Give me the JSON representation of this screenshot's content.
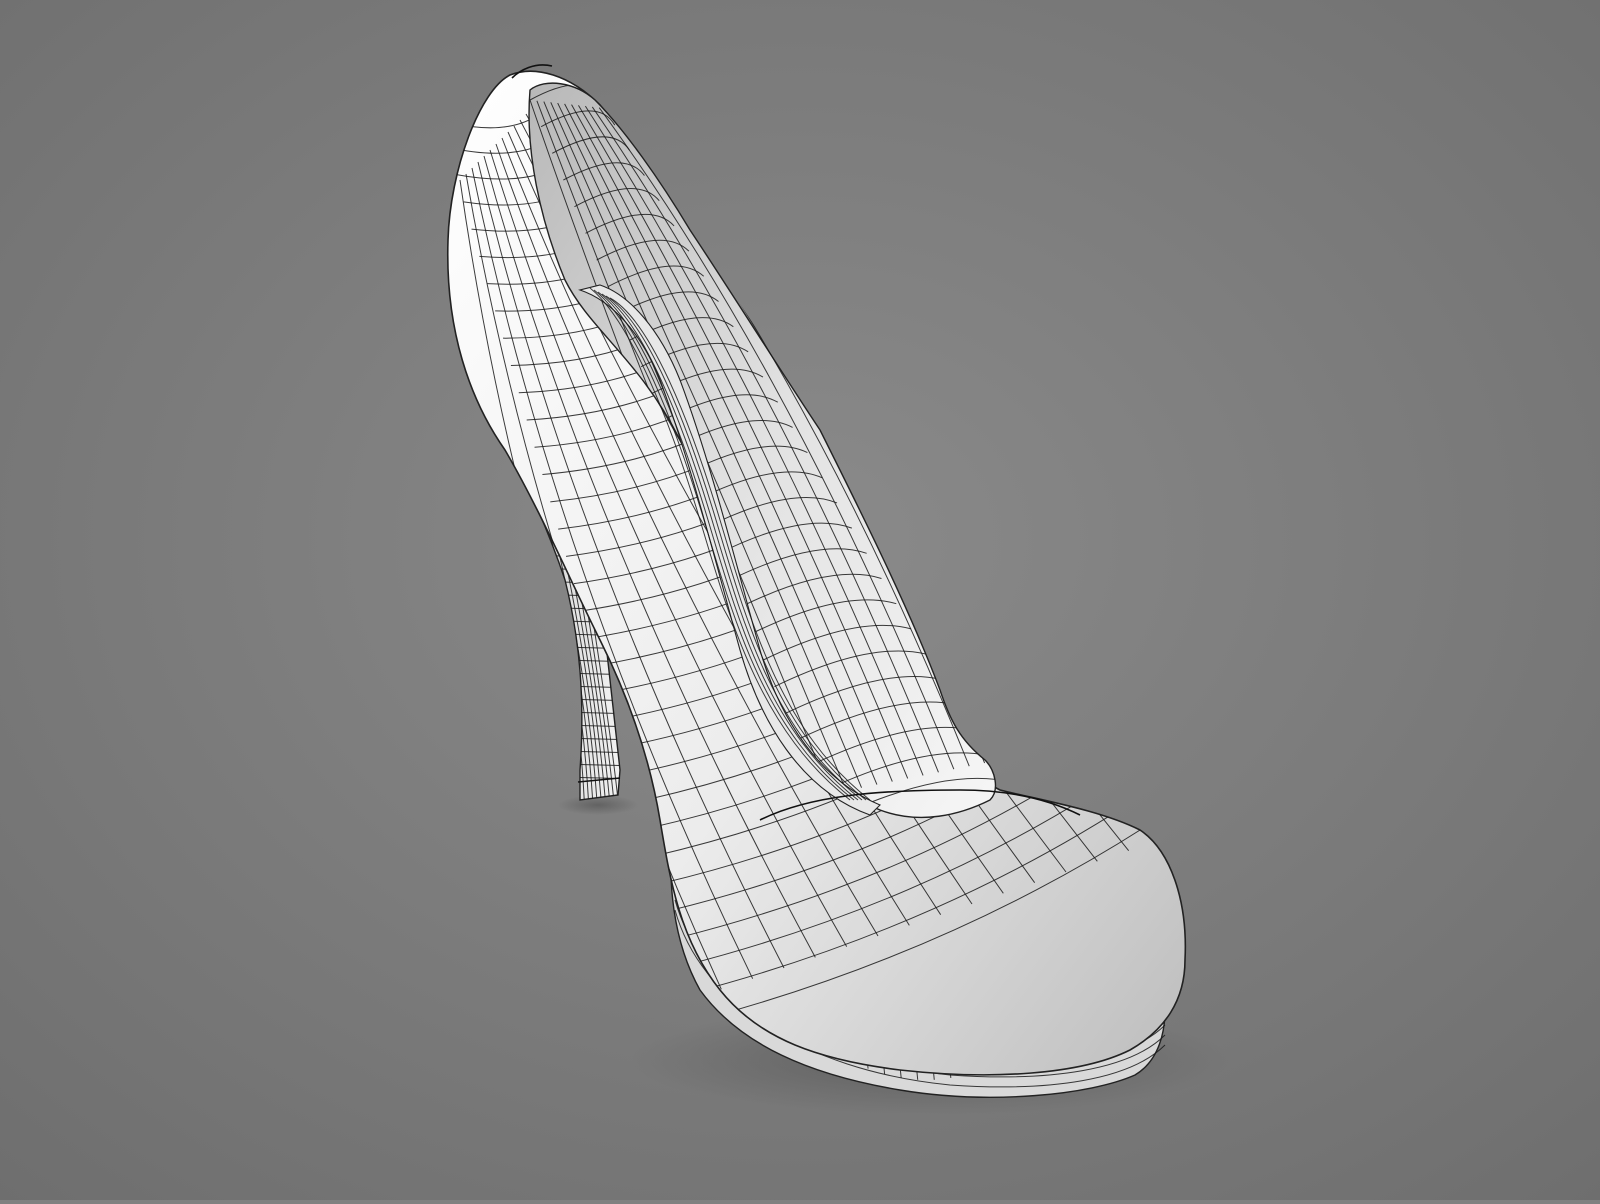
{
  "scene": {
    "background": "#808080",
    "subject": "shoe-wireframe-render",
    "surface_color": "#f4f4f4",
    "wire_color": "#1a1a1a",
    "icon": "high-heel-shoe"
  }
}
